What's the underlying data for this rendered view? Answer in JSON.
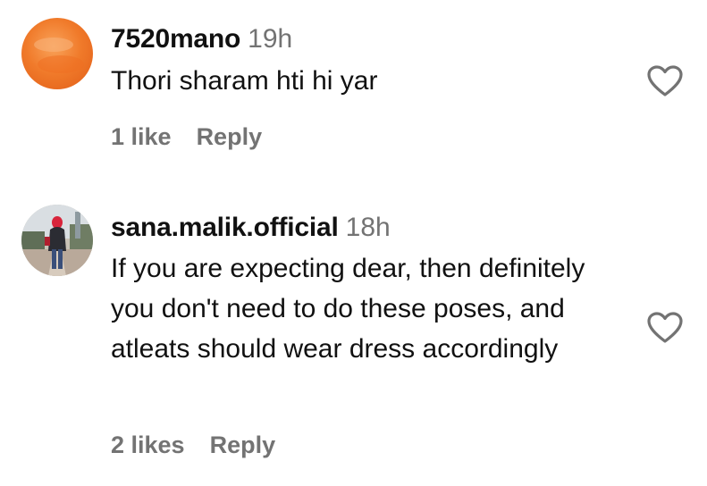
{
  "comments": [
    {
      "username": "7520mano",
      "time": "19h",
      "text": "Thori sharam hti hi yar",
      "likes": "1 like",
      "reply": "Reply",
      "avatar": "orange-blurred-avatar"
    },
    {
      "username": "sana.malik.official",
      "time": "18h",
      "text": "If you are expecting dear, then definitely you don't need to do these poses, and atleats should wear dress accordingly",
      "likes": "2 likes",
      "reply": "Reply",
      "avatar": "woman-in-red-hijab-avatar"
    }
  ],
  "colors": {
    "text": "#111111",
    "secondary": "#737373",
    "heart_outline": "#737373"
  }
}
